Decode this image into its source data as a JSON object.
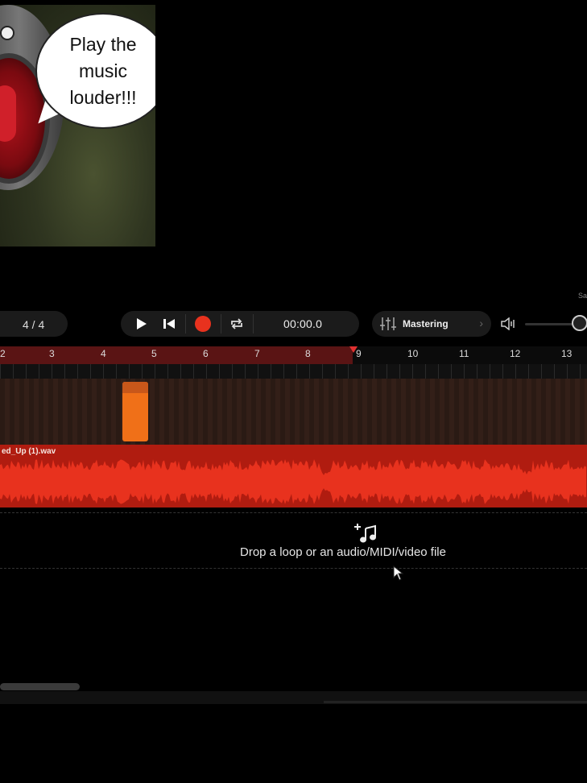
{
  "meme": {
    "bubble_text": "Play the music louder!!!"
  },
  "corner_label": "Sa",
  "toolbar": {
    "time_signature": "4 / 4",
    "time_display": "00:00.0",
    "mastering_label": "Mastering",
    "volume_level": 0.85
  },
  "ruler": {
    "bar_numbers": [
      "2",
      "3",
      "4",
      "5",
      "6",
      "7",
      "8",
      "9",
      "10",
      "11",
      "12",
      "13"
    ],
    "playhead_bar": 9
  },
  "tracks": {
    "audio_file_name": "ed_Up (1).wav"
  },
  "dropzone": {
    "text": "Drop a loop or an audio/MIDI/video file"
  },
  "colors": {
    "record": "#e8321e",
    "track_clip": "#f07018",
    "waveform": "#e8321e",
    "ruler_played": "#5a1414"
  }
}
